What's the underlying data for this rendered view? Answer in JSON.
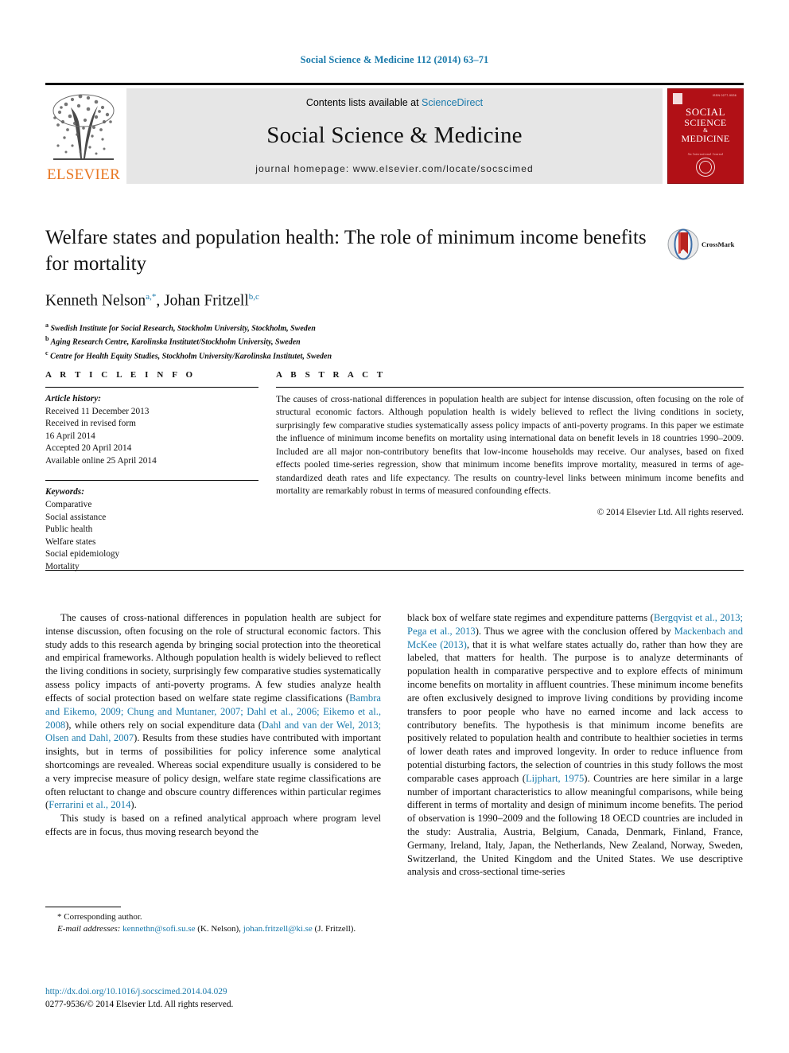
{
  "running_head": "Social Science & Medicine 112 (2014) 63–71",
  "masthead": {
    "contents_prefix": "Contents lists available at ",
    "sciencedirect": "ScienceDirect",
    "journal_title": "Social Science & Medicine",
    "homepage": "journal homepage: www.elsevier.com/locate/socscimed",
    "publisher_wordmark": "ELSEVIER",
    "publisher_color": "#E87722",
    "link_color": "#1a7aab",
    "band_color": "#e6e6e6",
    "cover": {
      "line1": "SOCIAL",
      "line2": "SCIENCE",
      "amp": "&",
      "line3": "MEDICINE",
      "subtitle": "An International Journal",
      "top_label": "ISSN 0277-9536",
      "color": "#b11016"
    }
  },
  "article": {
    "title": "Welfare states and population health: The role of minimum income benefits for mortality",
    "authors": [
      {
        "name": "Kenneth Nelson",
        "marks": "a,*"
      },
      {
        "name": "Johan Fritzell",
        "marks": "b,c"
      }
    ],
    "authors_plain": "Kenneth Nelson a,*, Johan Fritzell b,c",
    "affiliations": [
      {
        "mark": "a",
        "text": "Swedish Institute for Social Research, Stockholm University, Stockholm, Sweden"
      },
      {
        "mark": "b",
        "text": "Aging Research Centre, Karolinska Institutet/Stockholm University, Sweden"
      },
      {
        "mark": "c",
        "text": "Centre for Health Equity Studies, Stockholm University/Karolinska Institutet, Sweden"
      }
    ],
    "crossmark_label": "CrossMark"
  },
  "article_info": {
    "heading": "A R T I C L E   I N F O",
    "history_label": "Article history:",
    "history": [
      "Received 11 December 2013",
      "Received in revised form",
      "16 April 2014",
      "Accepted 20 April 2014",
      "Available online 25 April 2014"
    ],
    "keywords_label": "Keywords:",
    "keywords": [
      "Comparative",
      "Social assistance",
      "Public health",
      "Welfare states",
      "Social epidemiology",
      "Mortality"
    ]
  },
  "abstract": {
    "heading": "A B S T R A C T",
    "text": "The causes of cross-national differences in population health are subject for intense discussion, often focusing on the role of structural economic factors. Although population health is widely believed to reflect the living conditions in society, surprisingly few comparative studies systematically assess policy impacts of anti-poverty programs. In this paper we estimate the influence of minimum income benefits on mortality using international data on benefit levels in 18 countries 1990–2009. Included are all major non-contributory benefits that low-income households may receive. Our analyses, based on fixed effects pooled time-series regression, show that minimum income benefits improve mortality, measured in terms of age-standardized death rates and life expectancy. The results on country-level links between minimum income benefits and mortality are remarkably robust in terms of measured confounding effects.",
    "copyright": "© 2014 Elsevier Ltd. All rights reserved."
  },
  "body": {
    "left_col": {
      "para1_a": "The causes of cross-national differences in population health are subject for intense discussion, often focusing on the role of structural economic factors. This study adds to this research agenda by bringing social protection into the theoretical and empirical frameworks. Although population health is widely believed to reflect the living conditions in society, surprisingly few comparative studies systematically assess policy impacts of anti-poverty programs. A few studies analyze health effects of social protection based on welfare state regime classifications (",
      "ref1": "Bambra and Eikemo, 2009; Chung and Muntaner, 2007; Dahl et al., 2006; Eikemo et al., 2008",
      "para1_b": "), while others rely on social expenditure data (",
      "ref2": "Dahl and van der Wel, 2013; Olsen and Dahl, 2007",
      "para1_c": "). Results from these studies have contributed with important insights, but in terms of possibilities for policy inference some analytical shortcomings are revealed. Whereas social expenditure usually is considered to be a very imprecise measure of policy design, welfare state regime classifications are often reluctant to change and obscure country differences within particular regimes (",
      "ref3": "Ferrarini et al., 2014",
      "para1_d": ").",
      "para2": "This study is based on a refined analytical approach where program level effects are in focus, thus moving research beyond the"
    },
    "right_col": {
      "para_a": "black box of welfare state regimes and expenditure patterns (",
      "ref1": "Bergqvist et al., 2013; Pega et al., 2013",
      "para_b": "). Thus we agree with the conclusion offered by ",
      "ref2": "Mackenbach and McKee (2013)",
      "para_c": ", that it is what welfare states actually do, rather than how they are labeled, that matters for health. The purpose is to analyze determinants of population health in comparative perspective and to explore effects of minimum income benefits on mortality in affluent countries. These minimum income benefits are often exclusively designed to improve living conditions by providing income transfers to poor people who have no earned income and lack access to contributory benefits. The hypothesis is that minimum income benefits are positively related to population health and contribute to healthier societies in terms of lower death rates and improved longevity. In order to reduce influence from potential disturbing factors, the selection of countries in this study follows the most comparable cases approach (",
      "ref3": "Lijphart, 1975",
      "para_d": "). Countries are here similar in a large number of important characteristics to allow meaningful comparisons, while being different in terms of mortality and design of minimum income benefits. The period of observation is 1990–2009 and the following 18 OECD countries are included in the study: Australia, Austria, Belgium, Canada, Denmark, Finland, France, Germany, Ireland, Italy, Japan, the Netherlands, New Zealand, Norway, Sweden, Switzerland, the United Kingdom and the United States. We use descriptive analysis and cross-sectional time-series"
    }
  },
  "footnote": {
    "corresponding": "* Corresponding author.",
    "email_label": "E-mail addresses:",
    "email1": "kennethn@sofi.su.se",
    "email1_owner": "(K. Nelson),",
    "email2": "johan.fritzell@ki.se",
    "email2_owner": "(J. Fritzell)."
  },
  "doi": {
    "url": "http://dx.doi.org/10.1016/j.socscimed.2014.04.029",
    "issn_line": "0277-9536/© 2014 Elsevier Ltd. All rights reserved."
  }
}
